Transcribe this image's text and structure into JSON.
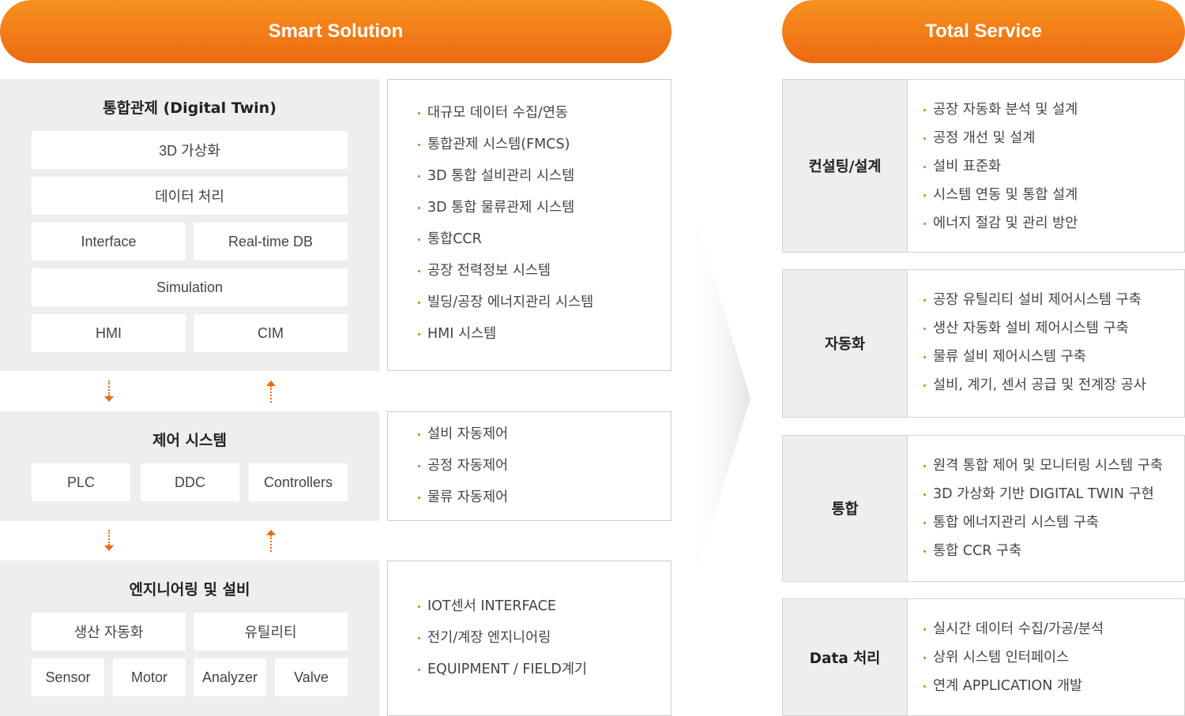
{
  "left_header": "Smart Solution",
  "right_header": "Total Service",
  "colors": {
    "accent": "#ec6a12",
    "accent_light": "#f7921e",
    "panel_gray": "#eeeeee"
  },
  "digital_twin": {
    "title": "통합관제 (Digital Twin)",
    "boxes": [
      "3D 가상화",
      "데이터 처리",
      "Interface",
      "Real-time DB",
      "Simulation",
      "HMI",
      "CIM"
    ],
    "items": [
      "대규모 데이터 수집/연동",
      "통합관제 시스템(FMCS)",
      "3D 통합 설비관리 시스템",
      "3D 통합 물류관제 시스템",
      "통합CCR",
      "공장 전력정보 시스템",
      "빌딩/공장 에너지관리 시스템",
      "HMI 시스템"
    ]
  },
  "control": {
    "title": "제어 시스템",
    "boxes": [
      "PLC",
      "DDC",
      "Controllers"
    ],
    "items": [
      "설비 자동제어",
      "공정 자동제어",
      "물류 자동제어"
    ]
  },
  "engineering": {
    "title": "엔지니어링 및 설비",
    "boxes": [
      "생산 자동화",
      "유틸리티",
      "Sensor",
      "Motor",
      "Analyzer",
      "Valve"
    ],
    "items": [
      "IOT센서 INTERFACE",
      "전기/계장 엔지니어링",
      "EQUIPMENT / FIELD계기"
    ]
  },
  "services": [
    {
      "label": "컨설팅/설계",
      "items": [
        "공장 자동화 분석 및 설계",
        "공정 개선 및 설계",
        "설비 표준화",
        "시스템 연동 및 통합 설계",
        "에너지 절감 및 관리 방안"
      ]
    },
    {
      "label": "자동화",
      "items": [
        "공장 유틸리티 설비 제어시스템 구축",
        "생산 자동화 설비 제어시스템 구축",
        "물류 설비 제어시스템 구축",
        "설비, 계기, 센서 공급 및 전계장 공사"
      ]
    },
    {
      "label": "통합",
      "items": [
        "원격 통합 제어 및 모니터링 시스템 구축",
        "3D 가상화 기반 DIGITAL TWIN 구현",
        "통합 에너지관리 시스템 구축",
        "통합 CCR 구축"
      ]
    },
    {
      "label": "Data 처리",
      "items": [
        "실시간 데이터 수집/가공/분석",
        "상위 시스템 인터페이스",
        "연계 APPLICATION 개발"
      ]
    }
  ]
}
